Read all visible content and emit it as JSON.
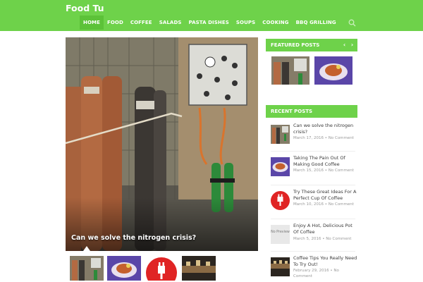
{
  "site": {
    "title": "Food Tu"
  },
  "nav": {
    "items": [
      {
        "label": "HOME"
      },
      {
        "label": "FOOD"
      },
      {
        "label": "COFFEE"
      },
      {
        "label": "SALADS"
      },
      {
        "label": "PASTA DISHES"
      },
      {
        "label": "SOUPS"
      },
      {
        "label": "COOKING"
      },
      {
        "label": "BBQ GRILLING"
      }
    ],
    "search_icon": "search-icon"
  },
  "hero": {
    "title": "Can we solve the nitrogen crisis?"
  },
  "sidebar": {
    "featured": {
      "heading": "FEATURED POSTS",
      "prev_icon": "chevron-left-icon",
      "next_icon": "chevron-right-icon"
    },
    "recent": {
      "heading": "RECENT POSTS",
      "posts": [
        {
          "title": "Can we solve the nitrogen crisis?",
          "meta": "March 17, 2016 • No Comment"
        },
        {
          "title": "Taking The Pain Out Of Making Good Coffee",
          "meta": "March 15, 2016 • No Comment"
        },
        {
          "title": "Try These Great Ideas For A Perfect Cup Of Coffee",
          "meta": "March 10, 2016 • No Comment"
        },
        {
          "title": "Enjoy A Hot, Delicious Pot Of Coffee",
          "meta": "March 5, 2016 • No Comment",
          "thumb_text": "No Preview"
        },
        {
          "title": "Coffee Tips You Really Need To Try Out!",
          "meta": "February 29, 2016 • No Comment"
        }
      ]
    }
  },
  "colors": {
    "brand": "#6ed24a",
    "brand_dark": "#5cc238",
    "plug_red": "#e02424"
  }
}
